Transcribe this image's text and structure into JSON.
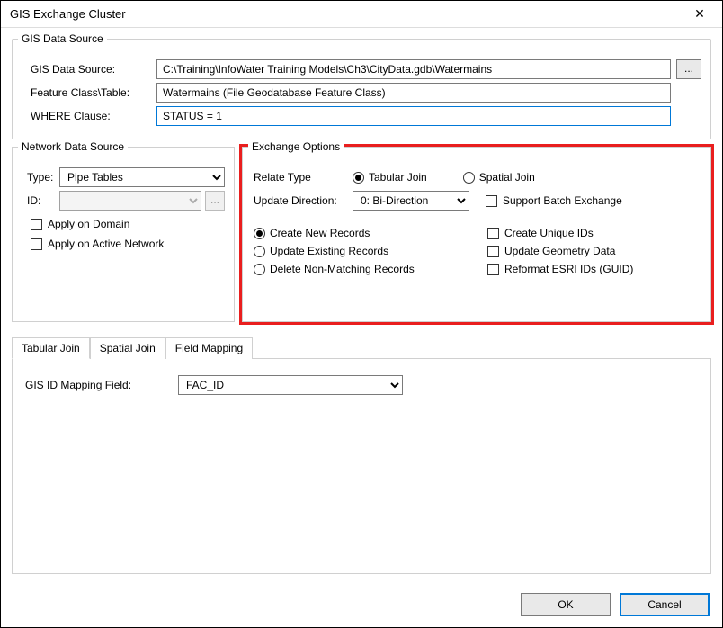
{
  "window": {
    "title": "GIS Exchange Cluster"
  },
  "gis_source": {
    "legend": "GIS Data Source",
    "source_label": "GIS Data Source:",
    "source_value": "C:\\Training\\InfoWater Training Models\\Ch3\\CityData.gdb\\Watermains",
    "browse_label": "...",
    "feature_label": "Feature Class\\Table:",
    "feature_value": "Watermains (File Geodatabase Feature Class)",
    "where_label": "WHERE Clause:",
    "where_value": "STATUS = 1"
  },
  "network_source": {
    "legend": "Network Data Source",
    "type_label": "Type:",
    "type_value": "Pipe Tables",
    "id_label": "ID:",
    "id_value": "",
    "id_browse": "...",
    "apply_domain": "Apply on Domain",
    "apply_active": "Apply on Active Network"
  },
  "exchange": {
    "legend": "Exchange Options",
    "relate_label": "Relate Type",
    "tabular_join": "Tabular Join",
    "spatial_join": "Spatial Join",
    "update_dir_label": "Update Direction:",
    "update_dir_value": "0: Bi-Direction",
    "create_new": "Create New Records",
    "update_existing": "Update Existing Records",
    "delete_nonmatch": "Delete Non-Matching Records",
    "support_batch": "Support Batch Exchange",
    "create_unique": "Create Unique IDs",
    "update_geom": "Update Geometry Data",
    "reformat_guid": "Reformat ESRI IDs (GUID)"
  },
  "tabs": {
    "tabular_join": "Tabular Join",
    "spatial_join": "Spatial Join",
    "field_mapping": "Field Mapping"
  },
  "tab_panel": {
    "mapping_label": "GIS ID Mapping Field:",
    "mapping_value": "FAC_ID"
  },
  "footer": {
    "ok": "OK",
    "cancel": "Cancel"
  }
}
